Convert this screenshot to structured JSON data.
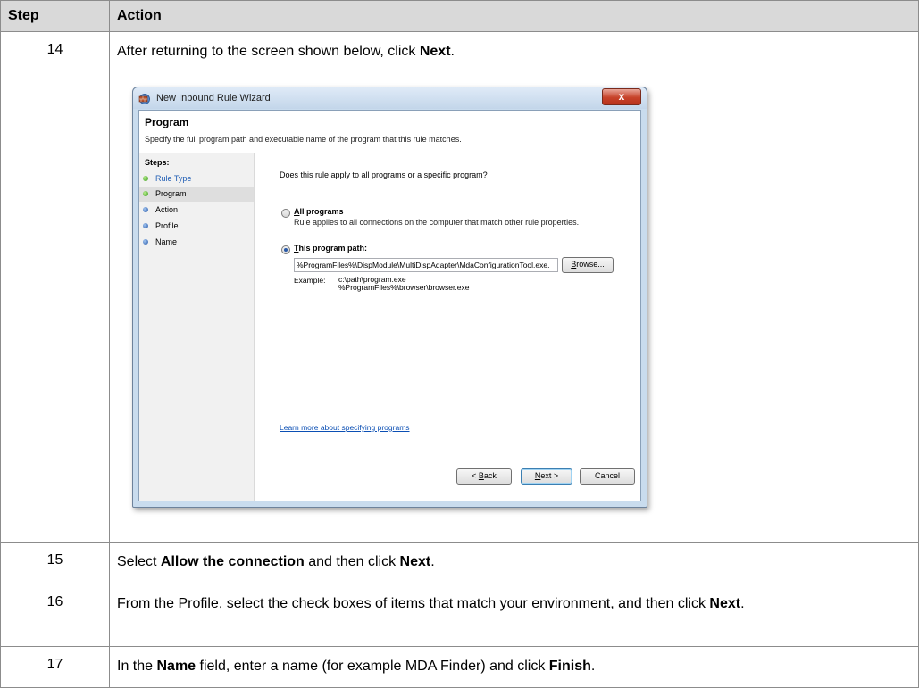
{
  "table": {
    "headers": {
      "step": "Step",
      "action": "Action"
    },
    "rows": [
      {
        "step": "14",
        "text_1": "After returning to the screen shown below, click ",
        "bold_1": "Next",
        "text_2": "."
      },
      {
        "step": "15",
        "text_1": "Select ",
        "bold_1": "Allow the connection",
        "text_2": " and then click ",
        "bold_2": "Next",
        "text_3": "."
      },
      {
        "step": "16",
        "text_1": "From the Profile, select the check boxes of items that match your environment, and then click ",
        "bold_1": "Next",
        "text_2": "."
      },
      {
        "step": "17",
        "text_1": "In the ",
        "bold_1": "Name",
        "text_2": " field, enter a name (for example MDA Finder) and click ",
        "bold_2": "Finish",
        "text_3": "."
      }
    ]
  },
  "wizard": {
    "title": "New Inbound Rule Wizard",
    "close_glyph": "x",
    "page_title": "Program",
    "page_description": "Specify the full program path and executable name of the program that this rule matches.",
    "steps_heading": "Steps:",
    "steps": [
      {
        "label": "Rule Type",
        "state": "done"
      },
      {
        "label": "Program",
        "state": "current"
      },
      {
        "label": "Action",
        "state": "pending"
      },
      {
        "label": "Profile",
        "state": "pending"
      },
      {
        "label": "Name",
        "state": "pending"
      }
    ],
    "question": "Does this rule apply to all programs or a specific program?",
    "option_all": {
      "label_first": "A",
      "label_rest": "ll programs",
      "description": "Rule applies to all connections on the computer that match other rule properties.",
      "selected": false
    },
    "option_path": {
      "label_first": "T",
      "label_rest": "his program path:",
      "selected": true
    },
    "program_path_value": "%ProgramFiles%\\DispModule\\MultiDispAdapter\\MdaConfigurationTool.exe.",
    "browse_first": "B",
    "browse_rest": "rowse...",
    "example_label": "Example:",
    "example_line_1": "c:\\path\\program.exe",
    "example_line_2": "%ProgramFiles%\\browser\\browser.exe",
    "learn_more_link": "Learn more about specifying programs",
    "back_prefix": "< ",
    "back_first": "B",
    "back_rest": "ack",
    "next_first": "N",
    "next_rest": "ext >",
    "cancel_label": "Cancel"
  },
  "colors": {
    "header_bg": "#d9d9d9",
    "close_button": "#c7432a",
    "link": "#0b4fb4",
    "step_done_dot": "#3b9a1e",
    "step_pending_dot": "#2a5aa8"
  }
}
